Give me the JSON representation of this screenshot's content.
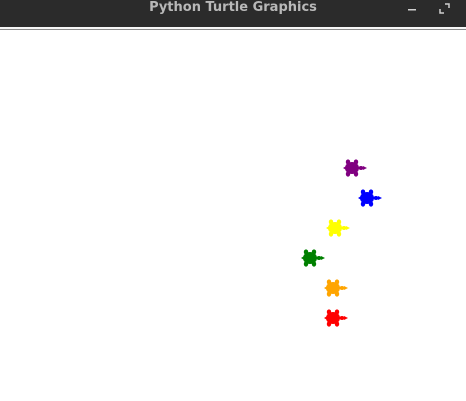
{
  "window": {
    "title": "Python Turtle Graphics",
    "controls": [
      "minimize",
      "maximize"
    ]
  },
  "canvas": {
    "background": "#ffffff",
    "turtles": [
      {
        "color": "#800080",
        "shape": "turtle-icon"
      },
      {
        "color": "#0000ff",
        "shape": "turtle-icon"
      },
      {
        "color": "#ffff00",
        "shape": "turtle-icon"
      },
      {
        "color": "#008000",
        "shape": "turtle-icon"
      },
      {
        "color": "#ffa500",
        "shape": "turtle-icon"
      },
      {
        "color": "#ff0000",
        "shape": "turtle-icon"
      }
    ]
  }
}
